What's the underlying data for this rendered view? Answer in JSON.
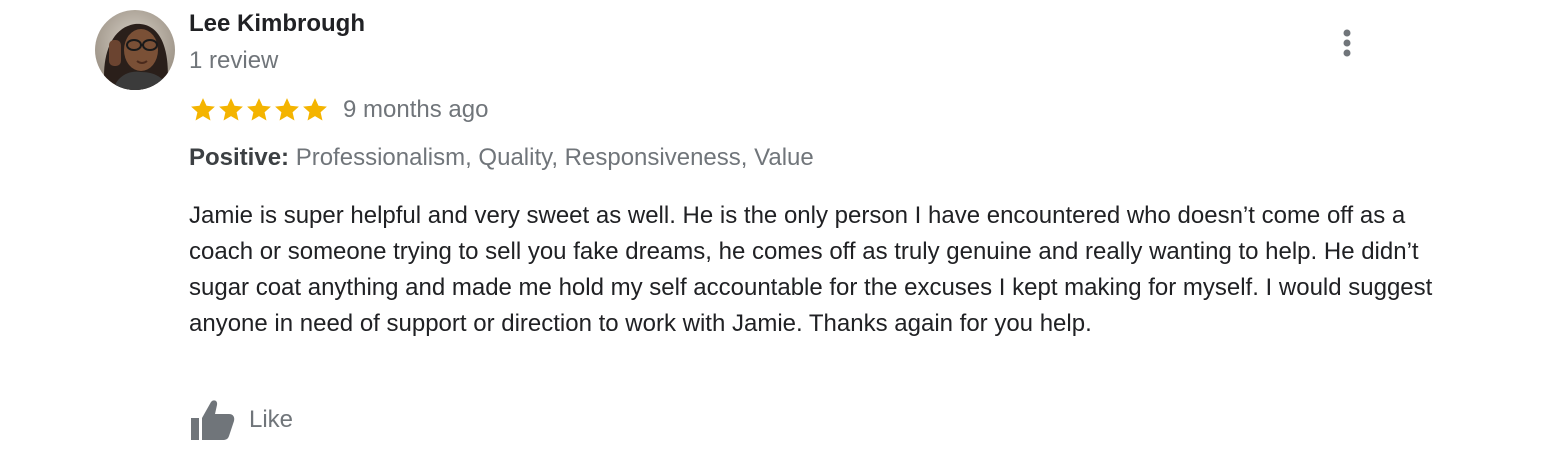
{
  "review": {
    "reviewer": {
      "name": "Lee Kimbrough",
      "review_count": "1 review",
      "avatar_icon": "user-avatar-photo"
    },
    "rating": {
      "stars": 5,
      "max_stars": 5,
      "star_color": "#f4b400",
      "time": "9 months ago"
    },
    "highlights": {
      "label": "Positive:",
      "value": "Professionalism, Quality, Responsiveness, Value"
    },
    "text": "Jamie is super helpful and very sweet as well. He is the only person I have encountered who doesn’t come off as a coach or someone trying to sell you fake dreams, he comes off as truly genuine and really wanting to help. He didn’t sugar coat anything and made me hold my self accountable for the excuses I kept making for myself. I would suggest anyone in need of support or direction to work with Jamie. Thanks again for you help.",
    "actions": {
      "like_label": "Like",
      "like_icon": "thumbs-up-icon",
      "more_icon": "more-vert-icon"
    }
  }
}
